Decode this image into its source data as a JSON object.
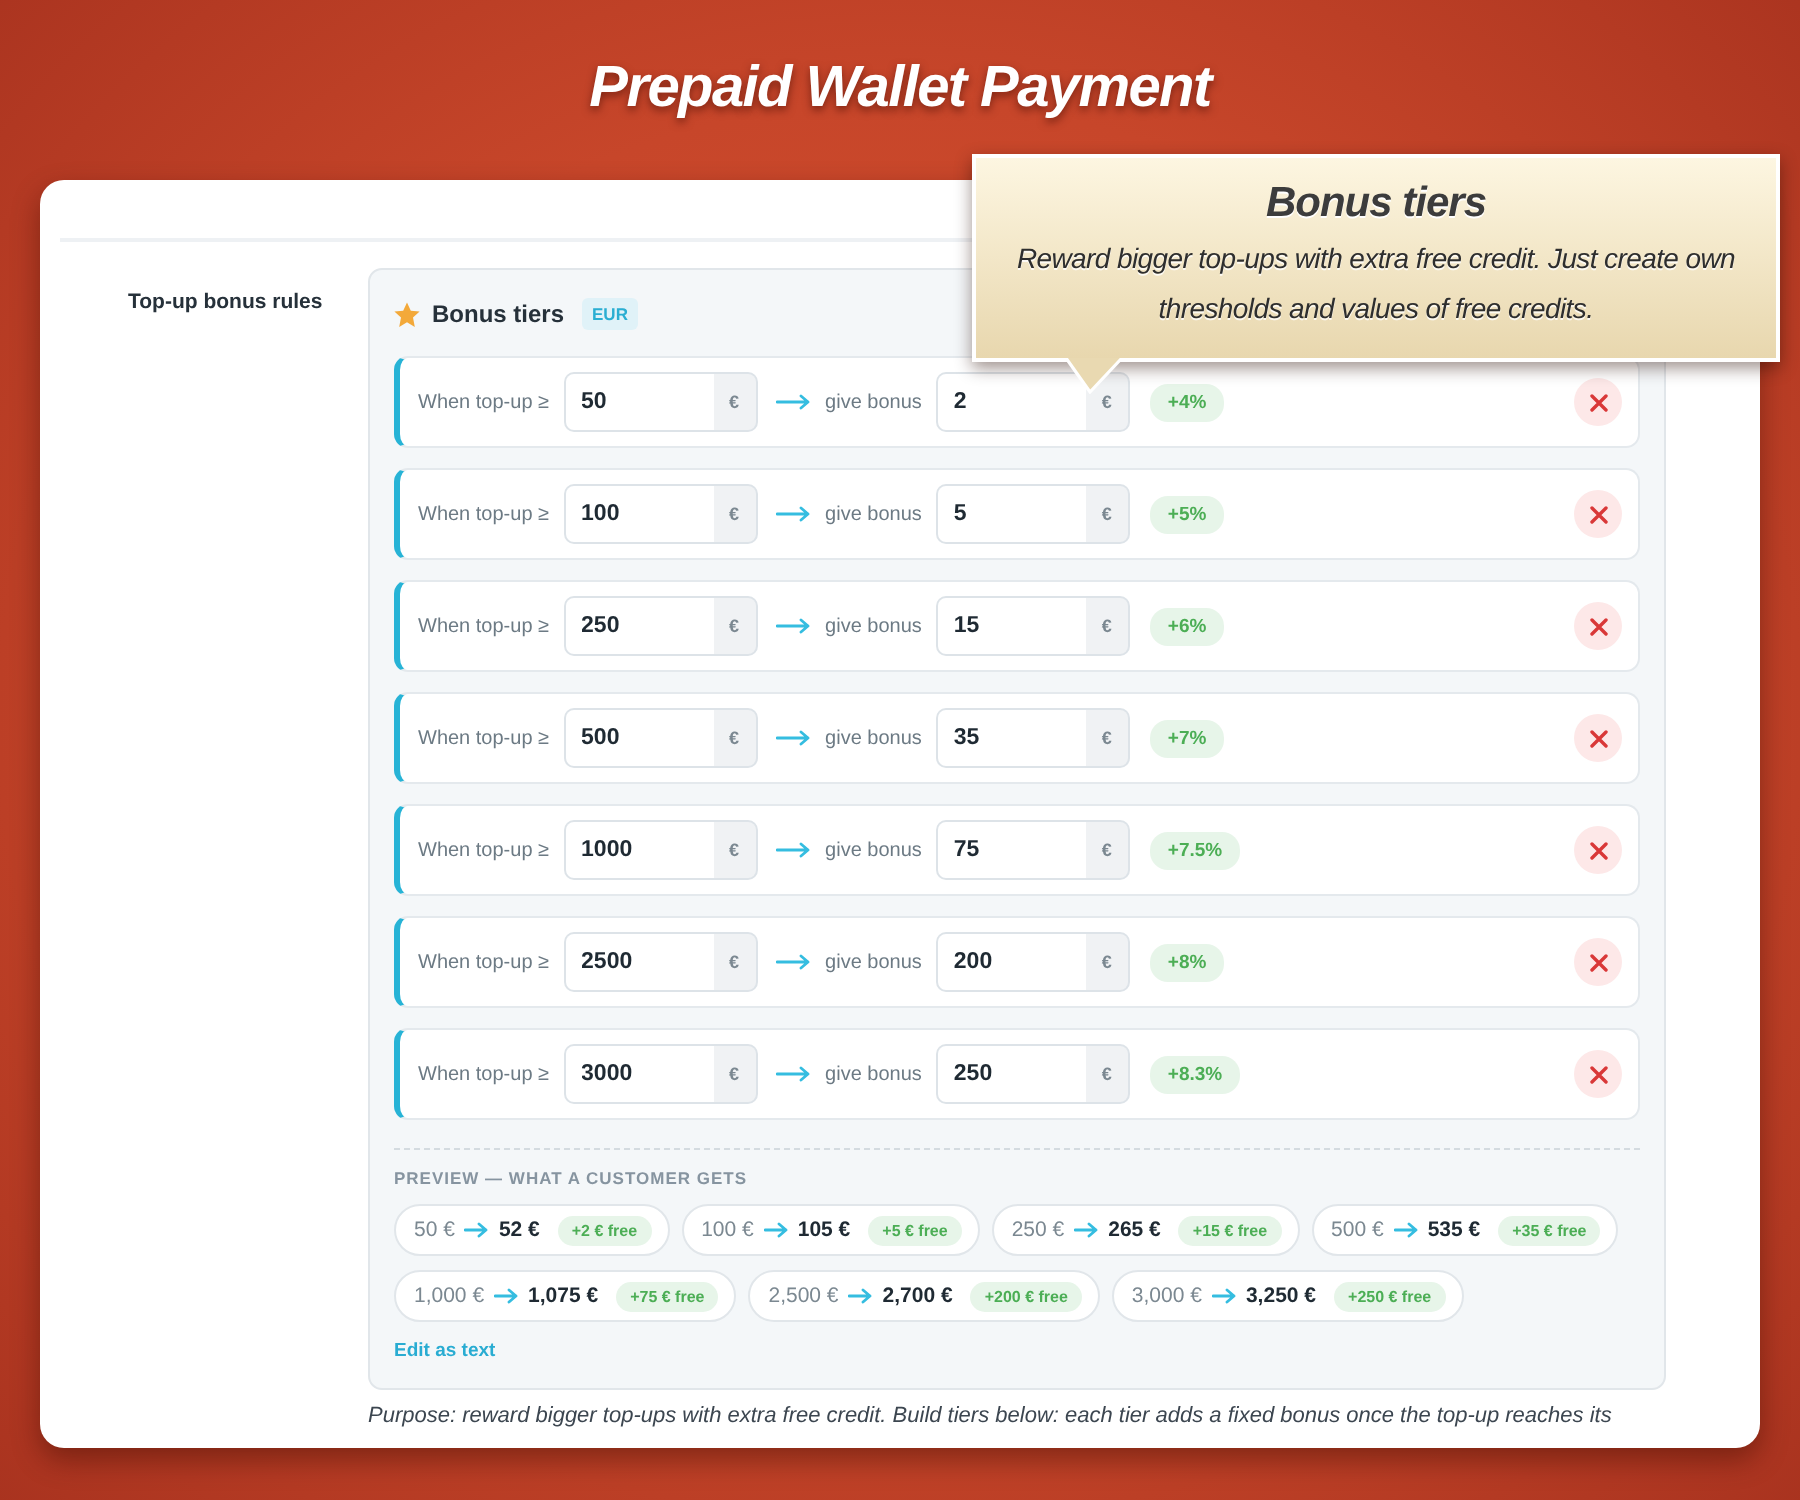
{
  "page_title": "Prepaid Wallet Payment",
  "callout": {
    "title": "Bonus tiers",
    "text": "Reward bigger top-ups with extra free credit. Just create own thresholds and values of free credits."
  },
  "setting": {
    "label": "Top-up bonus rules",
    "panel": {
      "title": "Bonus tiers",
      "currency_badge": "EUR",
      "tiers": [
        {
          "condition_label": "When top-up ≥",
          "threshold": "50",
          "threshold_unit": "€",
          "bonus_label": "give bonus",
          "bonus": "2",
          "bonus_unit": "€",
          "percent_badge": "+4%"
        },
        {
          "condition_label": "When top-up ≥",
          "threshold": "100",
          "threshold_unit": "€",
          "bonus_label": "give bonus",
          "bonus": "5",
          "bonus_unit": "€",
          "percent_badge": "+5%"
        },
        {
          "condition_label": "When top-up ≥",
          "threshold": "250",
          "threshold_unit": "€",
          "bonus_label": "give bonus",
          "bonus": "15",
          "bonus_unit": "€",
          "percent_badge": "+6%"
        },
        {
          "condition_label": "When top-up ≥",
          "threshold": "500",
          "threshold_unit": "€",
          "bonus_label": "give bonus",
          "bonus": "35",
          "bonus_unit": "€",
          "percent_badge": "+7%"
        },
        {
          "condition_label": "When top-up ≥",
          "threshold": "1000",
          "threshold_unit": "€",
          "bonus_label": "give bonus",
          "bonus": "75",
          "bonus_unit": "€",
          "percent_badge": "+7.5%"
        },
        {
          "condition_label": "When top-up ≥",
          "threshold": "2500",
          "threshold_unit": "€",
          "bonus_label": "give bonus",
          "bonus": "200",
          "bonus_unit": "€",
          "percent_badge": "+8%"
        },
        {
          "condition_label": "When top-up ≥",
          "threshold": "3000",
          "threshold_unit": "€",
          "bonus_label": "give bonus",
          "bonus": "250",
          "bonus_unit": "€",
          "percent_badge": "+8.3%"
        }
      ],
      "preview": {
        "heading": "PREVIEW — WHAT A CUSTOMER GETS",
        "items": [
          {
            "from": "50 €",
            "to": "52 €",
            "free": "+2 € free"
          },
          {
            "from": "100 €",
            "to": "105 €",
            "free": "+5 € free"
          },
          {
            "from": "250 €",
            "to": "265 €",
            "free": "+15 € free"
          },
          {
            "from": "500 €",
            "to": "535 €",
            "free": "+35 € free"
          },
          {
            "from": "1,000 €",
            "to": "1,075 €",
            "free": "+75 € free"
          },
          {
            "from": "2,500 €",
            "to": "2,700 €",
            "free": "+200 € free"
          },
          {
            "from": "3,000 €",
            "to": "3,250 €",
            "free": "+250 € free"
          }
        ],
        "edit_link": "Edit as text"
      }
    },
    "help_text": "Purpose: reward bigger top-ups with extra free credit. Build tiers below: each tier adds a fixed bonus once the top-up reaches its"
  }
}
